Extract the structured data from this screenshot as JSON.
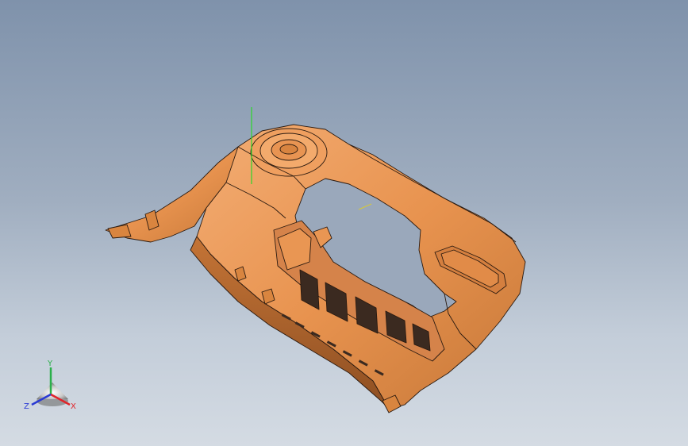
{
  "viewport": {
    "background_top": "#7f92ab",
    "background_bottom": "#d4dbe3"
  },
  "model": {
    "name_icon": "console-part-model",
    "body_color": "#e8934f",
    "shadow_color": "#b86a31",
    "highlight_color": "#f6b27a",
    "edge_color": "#2a1a10"
  },
  "triad": {
    "x_label": "X",
    "y_label": "Y",
    "z_label": "Z",
    "x_color": "#e0242a",
    "y_color": "#2bb04a",
    "z_color": "#2a3ad4"
  }
}
